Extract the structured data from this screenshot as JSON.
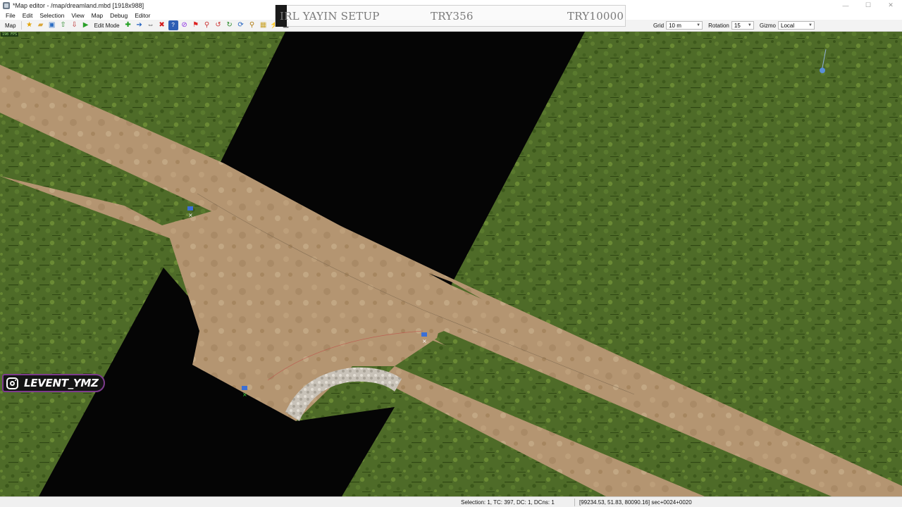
{
  "window": {
    "title": "*Map editor - /map/dreamland.mbd [1918x988]",
    "controls": {
      "minimize": "—",
      "maximize": "☐",
      "close": "✕"
    }
  },
  "menu": [
    "File",
    "Edit",
    "Selection",
    "View",
    "Map",
    "Debug",
    "Editor"
  ],
  "toolbar": {
    "map_label": "Map",
    "edit_mode_label": "Edit Mode",
    "grid_label": "Grid",
    "grid_value": "10 m",
    "rotation_label": "Rotation",
    "rotation_value": "15",
    "gizmo_label": "Gizmo",
    "gizmo_value": "Local",
    "icons": [
      {
        "name": "star-icon",
        "glyph": "★",
        "color": "#e3a400"
      },
      {
        "name": "open-folder-icon",
        "glyph": "▰",
        "color": "#d9a63a"
      },
      {
        "name": "save-icon",
        "glyph": "▣",
        "color": "#2f6fc4"
      },
      {
        "name": "export-icon",
        "glyph": "⇧",
        "color": "#2e8b2e"
      },
      {
        "name": "import-icon",
        "glyph": "⇩",
        "color": "#b33"
      },
      {
        "name": "play-icon",
        "glyph": "▶",
        "color": "#2aa02a"
      }
    ],
    "mode_icons": [
      {
        "name": "add-icon",
        "glyph": "✚",
        "color": "#1e9e1e"
      },
      {
        "name": "arrow-right-icon",
        "glyph": "➔",
        "color": "#1f5fbf"
      },
      {
        "name": "move-icon",
        "glyph": "⇔",
        "color": "#444"
      },
      {
        "name": "delete-icon",
        "glyph": "✖",
        "color": "#d21a1a"
      },
      {
        "name": "help-icon",
        "glyph": "?",
        "color": "#fff"
      },
      {
        "name": "no-entry-icon",
        "glyph": "⊘",
        "color": "#8a2be2"
      },
      {
        "name": "flag-icon",
        "glyph": "⚑",
        "color": "#d22"
      },
      {
        "name": "marker-icon",
        "glyph": "⚲",
        "color": "#c33"
      },
      {
        "name": "undo-icon",
        "glyph": "↺",
        "color": "#c33"
      },
      {
        "name": "redo-icon",
        "glyph": "↻",
        "color": "#2a8a2a"
      },
      {
        "name": "refresh-icon",
        "glyph": "⟳",
        "color": "#1f5fbf"
      },
      {
        "name": "pin-icon",
        "glyph": "⚲",
        "color": "#b07a10"
      },
      {
        "name": "table-icon",
        "glyph": "▦",
        "color": "#c9a227"
      },
      {
        "name": "bolt-icon",
        "glyph": "⚡",
        "color": "#2e8b2e"
      },
      {
        "name": "camera-icon",
        "glyph": "▩",
        "color": "#333"
      }
    ]
  },
  "overlay": {
    "title": "IRL YAYIN SETUP",
    "goal1": "TRY356",
    "goal2": "TRY10000"
  },
  "viewport": {
    "fps": "198 FPS"
  },
  "badge": {
    "handle": "LEVENT_YMZ"
  },
  "status": {
    "selection": "Selection: 1, TC: 397, DC: 1, DCns: 1",
    "coords": "[99234.53, 51.83, 80090.16] sec+0024+0020"
  }
}
